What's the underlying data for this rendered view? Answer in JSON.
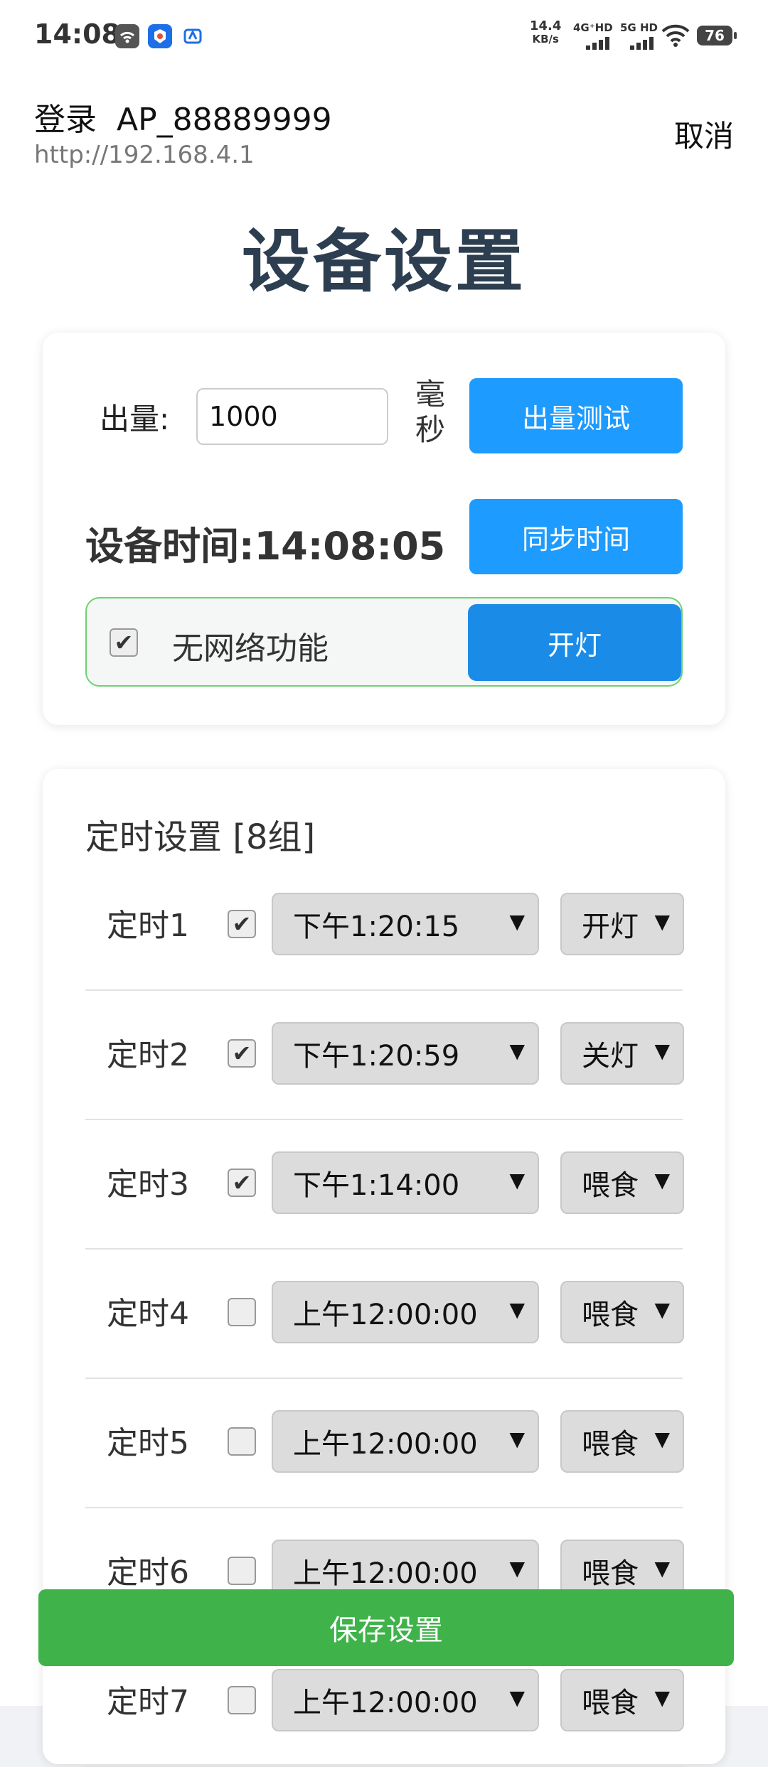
{
  "status_bar": {
    "time": "14:08",
    "speed_value": "14.4",
    "speed_unit": "KB/s",
    "net1": "4G⁺HD",
    "net2": "5G HD",
    "battery": "76"
  },
  "dialog": {
    "title": "登录  AP_88889999",
    "url": "http://192.168.4.1",
    "cancel_label": "取消"
  },
  "page": {
    "title": "设备设置"
  },
  "device": {
    "output_label": "出量:",
    "output_value": "1000",
    "unit": "毫秒",
    "test_button": "出量测试",
    "time_text": "设备时间:14:08:05",
    "sync_button": "同步时间",
    "no_network_label": "无网络功能",
    "no_network_checked": "✔",
    "light_button": "开灯"
  },
  "timers": {
    "header": "定时设置 [8组]",
    "rows": [
      {
        "label": "定时1",
        "check": "✔",
        "time": "下午1:20:15",
        "action": "开灯"
      },
      {
        "label": "定时2",
        "check": "✔",
        "time": "下午1:20:59",
        "action": "关灯"
      },
      {
        "label": "定时3",
        "check": "✔",
        "time": "下午1:14:00",
        "action": "喂食"
      },
      {
        "label": "定时4",
        "check": "",
        "time": "上午12:00:00",
        "action": "喂食"
      },
      {
        "label": "定时5",
        "check": "",
        "time": "上午12:00:00",
        "action": "喂食"
      },
      {
        "label": "定时6",
        "check": "",
        "time": "上午12:00:00",
        "action": "喂食"
      },
      {
        "label": "定时7",
        "check": "",
        "time": "上午12:00:00",
        "action": "喂食"
      }
    ]
  },
  "save_button": "保存设置",
  "colors": {
    "primary_blue": "#1e9bff",
    "save_green": "#3fb34a",
    "title_color": "#2c3e50"
  }
}
